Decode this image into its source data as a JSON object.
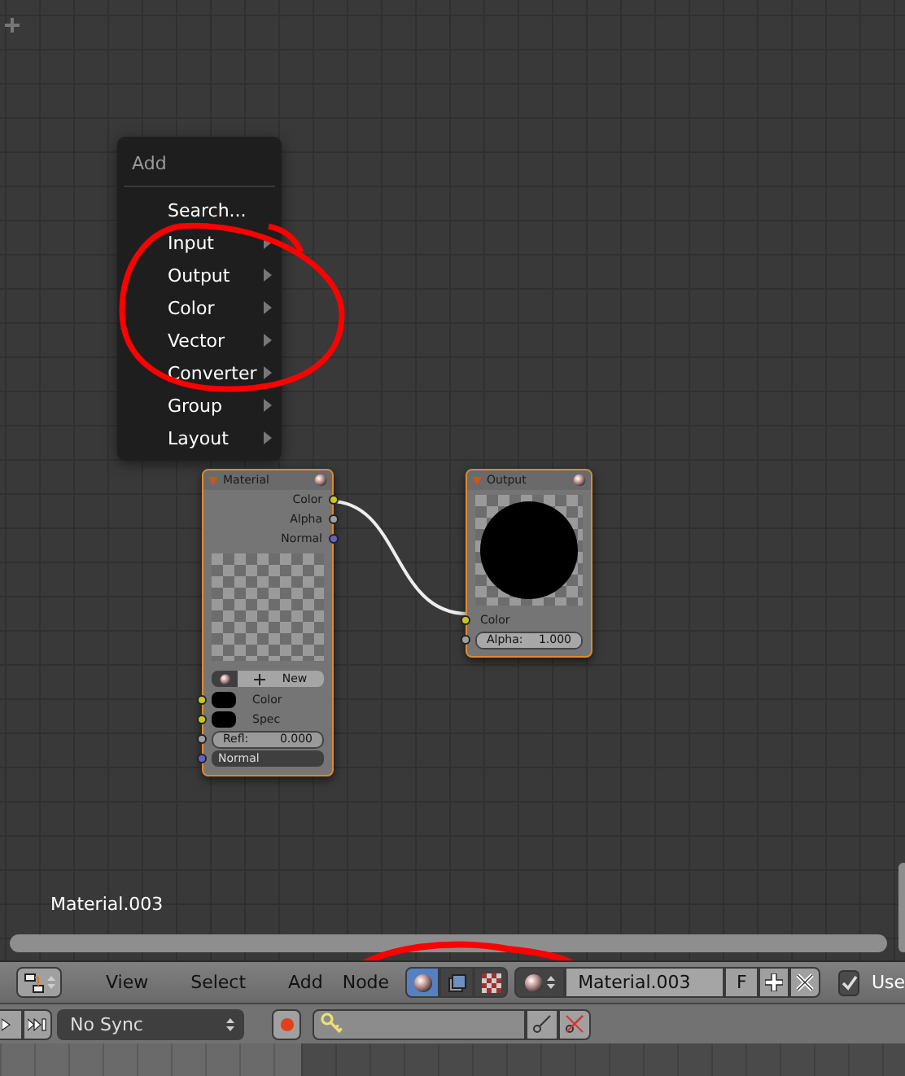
{
  "add_menu": {
    "title": "Add",
    "items": [
      {
        "label": "Search...",
        "kind": "action"
      },
      {
        "label": "Input",
        "kind": "submenu"
      },
      {
        "label": "Output",
        "kind": "submenu"
      },
      {
        "label": "Color",
        "kind": "submenu"
      },
      {
        "label": "Vector",
        "kind": "submenu"
      },
      {
        "label": "Converter",
        "kind": "submenu"
      },
      {
        "label": "Group",
        "kind": "submenu"
      },
      {
        "label": "Layout",
        "kind": "submenu"
      }
    ]
  },
  "material_node": {
    "title": "Material",
    "outputs": [
      {
        "label": "Color",
        "color": "#c7c729"
      },
      {
        "label": "Alpha",
        "color": "#a0a0a0"
      },
      {
        "label": "Normal",
        "color": "#6363c7"
      }
    ],
    "browse_label": "New",
    "inputs": [
      {
        "kind": "swatch",
        "label": "Color",
        "color": "#c7c729"
      },
      {
        "kind": "swatch",
        "label": "Spec",
        "color": "#c7c729"
      },
      {
        "kind": "slider",
        "label": "Refl:",
        "value": "0.000",
        "level": 0,
        "color": "#a0a0a0"
      },
      {
        "kind": "dropdown",
        "value": "Normal",
        "color": "#6363c7"
      }
    ]
  },
  "output_node": {
    "title": "Output",
    "inputs": [
      {
        "kind": "socket",
        "label": "Color",
        "color": "#c7c729"
      },
      {
        "kind": "slider",
        "label": "Alpha:",
        "value": "1.000",
        "level": 1,
        "color": "#a0a0a0"
      }
    ]
  },
  "material_label": "Material.003",
  "header": {
    "menus": [
      "View",
      "Select",
      "Add",
      "Node"
    ],
    "shader_types": [
      {
        "kind": "shader",
        "selected": true
      },
      {
        "kind": "compositing",
        "selected": false
      },
      {
        "kind": "texture",
        "selected": false
      }
    ],
    "material_name": "Material.003",
    "fake_user": "F",
    "use_nodes": {
      "label": "Use",
      "checked": true
    }
  },
  "timeline": {
    "sync": "No Sync"
  }
}
